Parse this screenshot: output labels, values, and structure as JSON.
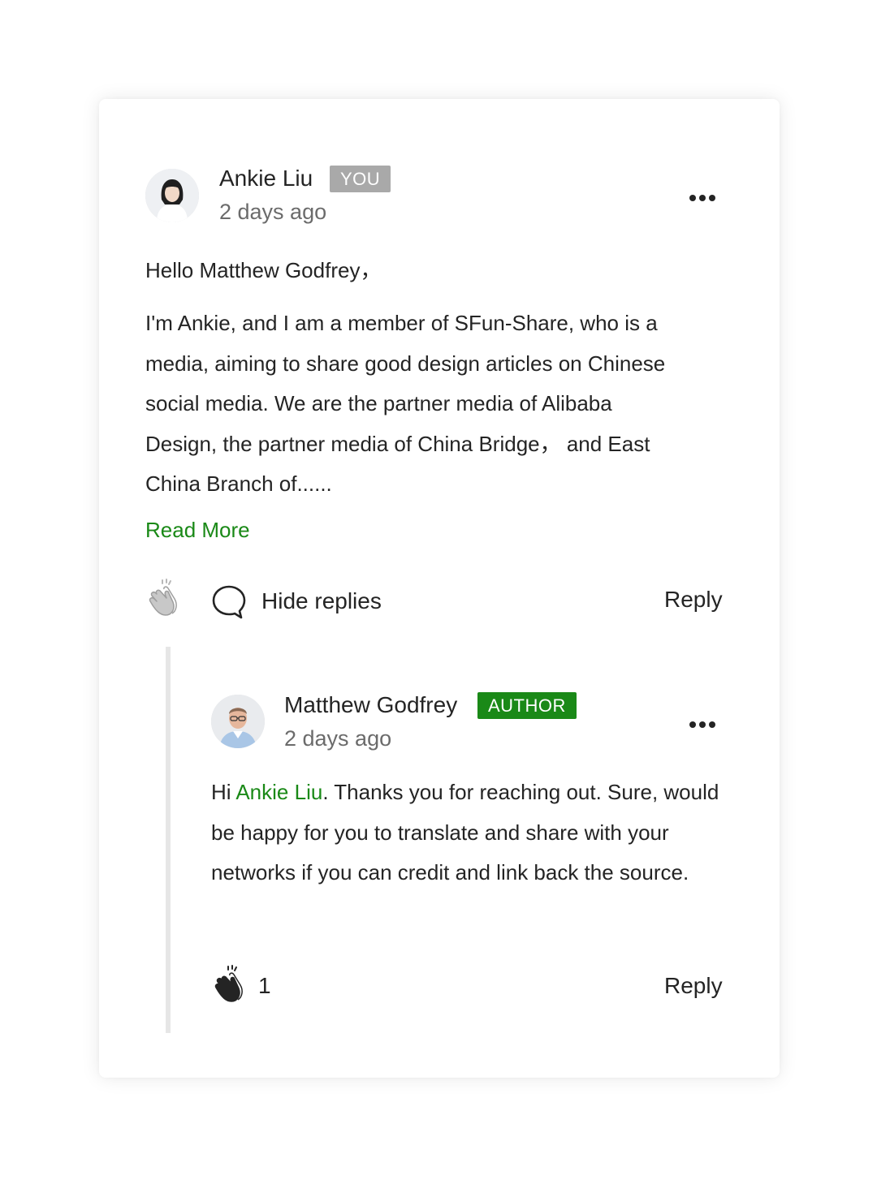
{
  "comment": {
    "author_name": "Ankie Liu",
    "author_badge": "YOU",
    "time_ago": "2 days ago",
    "greeting": "Hello Matthew Godfrey，",
    "body_lines": [
      "I'm Ankie, and I am a member of SFun-Share, who is a",
      "media, aiming to share good design articles on Chinese",
      "social media. We are the partner media of Alibaba",
      "Design, the partner media of China Bridge， and East",
      "China Branch of......"
    ],
    "read_more_label": "Read More",
    "hide_replies_label": "Hide replies",
    "reply_label": "Reply"
  },
  "reply": {
    "author_name": "Matthew Godfrey",
    "author_badge": "AUTHOR",
    "time_ago": "2 days ago",
    "body_prefix": "Hi ",
    "mention": "Ankie Liu",
    "body_rest": ". Thanks you for reaching out. Sure, would be happy for you to translate and share with your networks if you can credit and link back the source.",
    "clap_count": "1",
    "reply_label": "Reply"
  },
  "colors": {
    "accent_green": "#1a8917",
    "you_badge_gray": "#a9a9a9",
    "text_primary": "#242424",
    "text_secondary": "#6b6b6b",
    "thread_line": "#e6e6e6"
  },
  "icons": {
    "more": "more-horizontal-icon",
    "clap": "clap-icon",
    "comment": "comment-bubble-icon"
  }
}
